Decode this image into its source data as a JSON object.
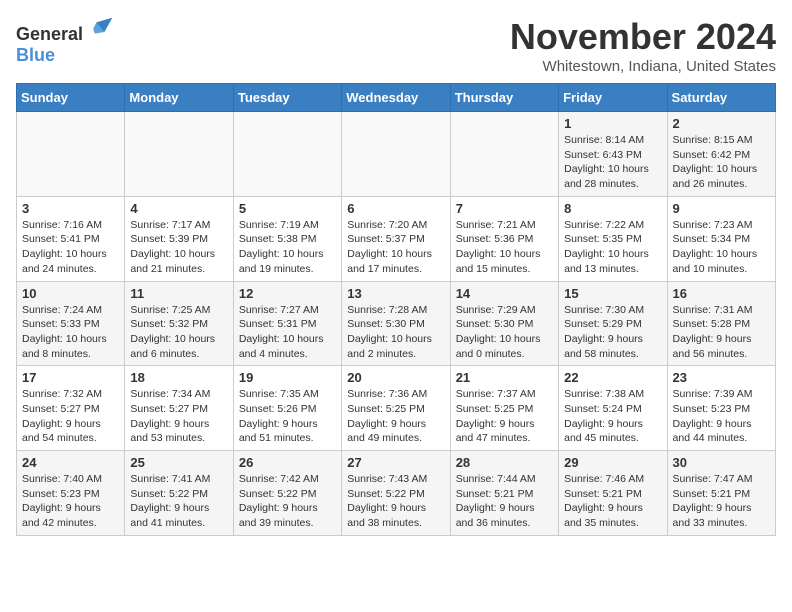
{
  "header": {
    "logo_general": "General",
    "logo_blue": "Blue",
    "month_title": "November 2024",
    "location": "Whitestown, Indiana, United States"
  },
  "days_of_week": [
    "Sunday",
    "Monday",
    "Tuesday",
    "Wednesday",
    "Thursday",
    "Friday",
    "Saturday"
  ],
  "weeks": [
    [
      {
        "day": "",
        "info": ""
      },
      {
        "day": "",
        "info": ""
      },
      {
        "day": "",
        "info": ""
      },
      {
        "day": "",
        "info": ""
      },
      {
        "day": "",
        "info": ""
      },
      {
        "day": "1",
        "info": "Sunrise: 8:14 AM\nSunset: 6:43 PM\nDaylight: 10 hours and 28 minutes."
      },
      {
        "day": "2",
        "info": "Sunrise: 8:15 AM\nSunset: 6:42 PM\nDaylight: 10 hours and 26 minutes."
      }
    ],
    [
      {
        "day": "3",
        "info": "Sunrise: 7:16 AM\nSunset: 5:41 PM\nDaylight: 10 hours and 24 minutes."
      },
      {
        "day": "4",
        "info": "Sunrise: 7:17 AM\nSunset: 5:39 PM\nDaylight: 10 hours and 21 minutes."
      },
      {
        "day": "5",
        "info": "Sunrise: 7:19 AM\nSunset: 5:38 PM\nDaylight: 10 hours and 19 minutes."
      },
      {
        "day": "6",
        "info": "Sunrise: 7:20 AM\nSunset: 5:37 PM\nDaylight: 10 hours and 17 minutes."
      },
      {
        "day": "7",
        "info": "Sunrise: 7:21 AM\nSunset: 5:36 PM\nDaylight: 10 hours and 15 minutes."
      },
      {
        "day": "8",
        "info": "Sunrise: 7:22 AM\nSunset: 5:35 PM\nDaylight: 10 hours and 13 minutes."
      },
      {
        "day": "9",
        "info": "Sunrise: 7:23 AM\nSunset: 5:34 PM\nDaylight: 10 hours and 10 minutes."
      }
    ],
    [
      {
        "day": "10",
        "info": "Sunrise: 7:24 AM\nSunset: 5:33 PM\nDaylight: 10 hours and 8 minutes."
      },
      {
        "day": "11",
        "info": "Sunrise: 7:25 AM\nSunset: 5:32 PM\nDaylight: 10 hours and 6 minutes."
      },
      {
        "day": "12",
        "info": "Sunrise: 7:27 AM\nSunset: 5:31 PM\nDaylight: 10 hours and 4 minutes."
      },
      {
        "day": "13",
        "info": "Sunrise: 7:28 AM\nSunset: 5:30 PM\nDaylight: 10 hours and 2 minutes."
      },
      {
        "day": "14",
        "info": "Sunrise: 7:29 AM\nSunset: 5:30 PM\nDaylight: 10 hours and 0 minutes."
      },
      {
        "day": "15",
        "info": "Sunrise: 7:30 AM\nSunset: 5:29 PM\nDaylight: 9 hours and 58 minutes."
      },
      {
        "day": "16",
        "info": "Sunrise: 7:31 AM\nSunset: 5:28 PM\nDaylight: 9 hours and 56 minutes."
      }
    ],
    [
      {
        "day": "17",
        "info": "Sunrise: 7:32 AM\nSunset: 5:27 PM\nDaylight: 9 hours and 54 minutes."
      },
      {
        "day": "18",
        "info": "Sunrise: 7:34 AM\nSunset: 5:27 PM\nDaylight: 9 hours and 53 minutes."
      },
      {
        "day": "19",
        "info": "Sunrise: 7:35 AM\nSunset: 5:26 PM\nDaylight: 9 hours and 51 minutes."
      },
      {
        "day": "20",
        "info": "Sunrise: 7:36 AM\nSunset: 5:25 PM\nDaylight: 9 hours and 49 minutes."
      },
      {
        "day": "21",
        "info": "Sunrise: 7:37 AM\nSunset: 5:25 PM\nDaylight: 9 hours and 47 minutes."
      },
      {
        "day": "22",
        "info": "Sunrise: 7:38 AM\nSunset: 5:24 PM\nDaylight: 9 hours and 45 minutes."
      },
      {
        "day": "23",
        "info": "Sunrise: 7:39 AM\nSunset: 5:23 PM\nDaylight: 9 hours and 44 minutes."
      }
    ],
    [
      {
        "day": "24",
        "info": "Sunrise: 7:40 AM\nSunset: 5:23 PM\nDaylight: 9 hours and 42 minutes."
      },
      {
        "day": "25",
        "info": "Sunrise: 7:41 AM\nSunset: 5:22 PM\nDaylight: 9 hours and 41 minutes."
      },
      {
        "day": "26",
        "info": "Sunrise: 7:42 AM\nSunset: 5:22 PM\nDaylight: 9 hours and 39 minutes."
      },
      {
        "day": "27",
        "info": "Sunrise: 7:43 AM\nSunset: 5:22 PM\nDaylight: 9 hours and 38 minutes."
      },
      {
        "day": "28",
        "info": "Sunrise: 7:44 AM\nSunset: 5:21 PM\nDaylight: 9 hours and 36 minutes."
      },
      {
        "day": "29",
        "info": "Sunrise: 7:46 AM\nSunset: 5:21 PM\nDaylight: 9 hours and 35 minutes."
      },
      {
        "day": "30",
        "info": "Sunrise: 7:47 AM\nSunset: 5:21 PM\nDaylight: 9 hours and 33 minutes."
      }
    ]
  ]
}
